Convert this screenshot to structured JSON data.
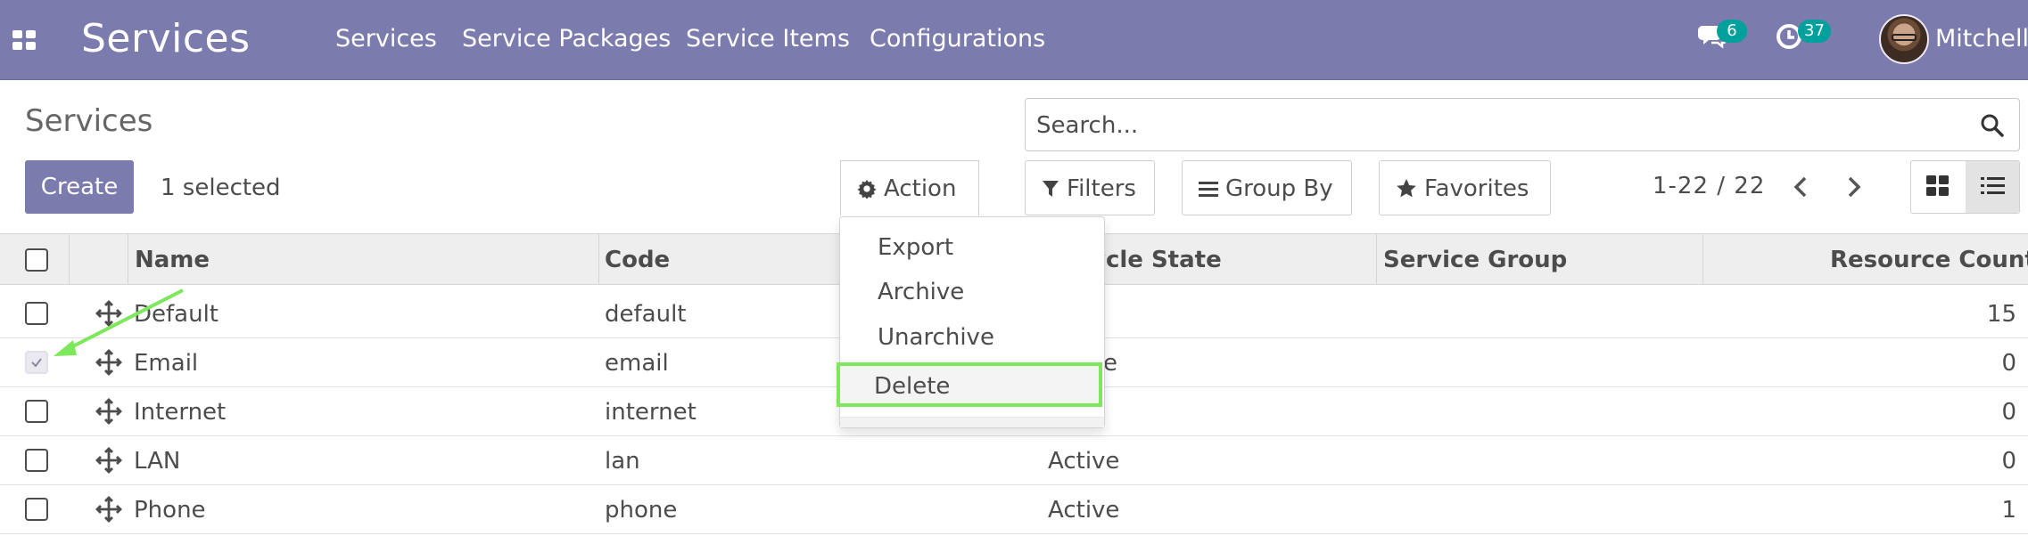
{
  "navbar": {
    "app_name": "Services",
    "menu": [
      "Services",
      "Service Packages",
      "Service Items",
      "Configurations"
    ],
    "messages_badge": "6",
    "activities_badge": "37",
    "user_name": "Mitchell"
  },
  "control_panel": {
    "title": "Services",
    "search_placeholder": "Search...",
    "create_label": "Create",
    "selected_text": "1 selected",
    "action_label": "Action",
    "filters_label": "Filters",
    "groupby_label": "Group By",
    "favorites_label": "Favorites",
    "pager": "1-22 / 22"
  },
  "action_menu": {
    "items": [
      "Export",
      "Archive",
      "Unarchive",
      "Delete"
    ],
    "highlighted": "Delete"
  },
  "table": {
    "columns": [
      "Name",
      "Code",
      "ycle State",
      "Service Group",
      "Resource Count"
    ],
    "rows": [
      {
        "name": "Default",
        "code": "default",
        "state": "",
        "group": "",
        "count": "15",
        "checked": false
      },
      {
        "name": "Email",
        "code": "email",
        "state": "e",
        "group": "",
        "count": "0",
        "checked": true
      },
      {
        "name": "Internet",
        "code": "internet",
        "state": "",
        "group": "",
        "count": "0",
        "checked": false
      },
      {
        "name": "LAN",
        "code": "lan",
        "state": "Active",
        "group": "",
        "count": "0",
        "checked": false
      },
      {
        "name": "Phone",
        "code": "phone",
        "state": "Active",
        "group": "",
        "count": "1",
        "checked": false
      }
    ]
  },
  "colors": {
    "brand": "#7c7bad",
    "badge": "#00a09d",
    "highlight": "#7de85c"
  }
}
